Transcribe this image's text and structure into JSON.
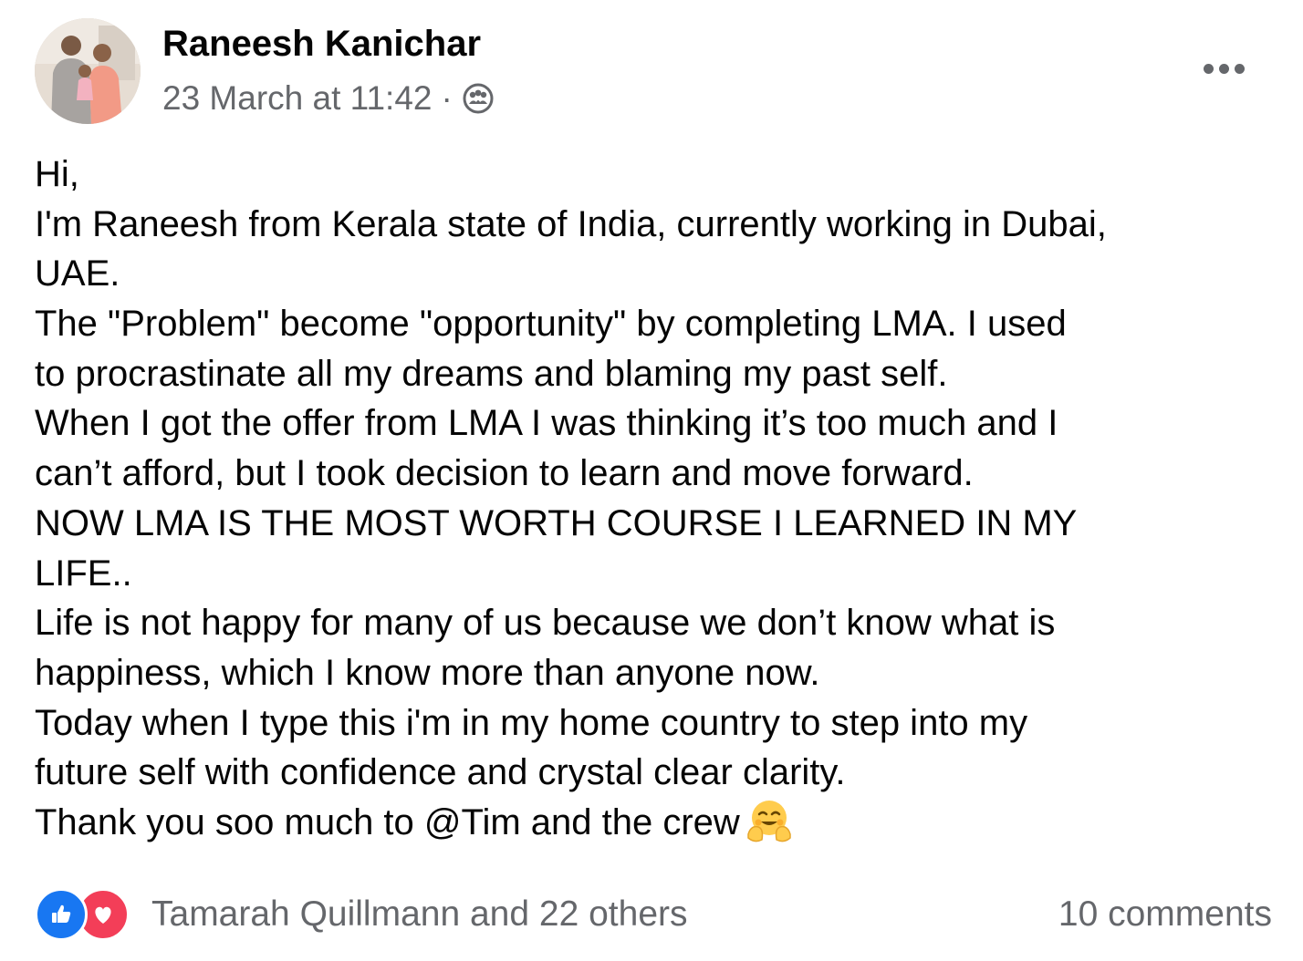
{
  "post": {
    "author": "Raneesh Kanichar",
    "timestamp": "23 March at 11:42",
    "separator": "·",
    "audience_icon": "group-audience-icon",
    "more_icon": "more-options-icon",
    "body_lines": [
      "Hi,",
      "I'm Raneesh from Kerala state of India, currently working in Dubai,",
      "UAE.",
      "The \"Problem\" become \"opportunity\" by completing LMA. I used",
      "to procrastinate all my dreams and blaming my past self.",
      "When I got the offer from LMA I was thinking it’s too much and I",
      "can’t afford, but I took decision to learn and move forward.",
      "NOW LMA IS THE MOST WORTH COURSE I LEARNED IN MY",
      "LIFE..",
      "Life is not happy for many of us because we don’t know what is",
      "happiness, which I know more than anyone now.",
      "Today when I type this i'm in my home country to step into my",
      "future self with confidence and crystal clear clarity.",
      "Thank you soo much to @Tim and the crew"
    ],
    "trailing_emoji": "smiling-face-with-open-hands-emoji"
  },
  "footer": {
    "reactions": [
      "like-reaction-icon",
      "love-reaction-icon"
    ],
    "reactors_text": "Tamarah Quillmann and 22 others",
    "comments_text": "10 comments"
  },
  "colors": {
    "text_primary": "#050505",
    "text_secondary": "#65676b",
    "like_blue": "#1877f2",
    "love_red": "#f33e58"
  }
}
